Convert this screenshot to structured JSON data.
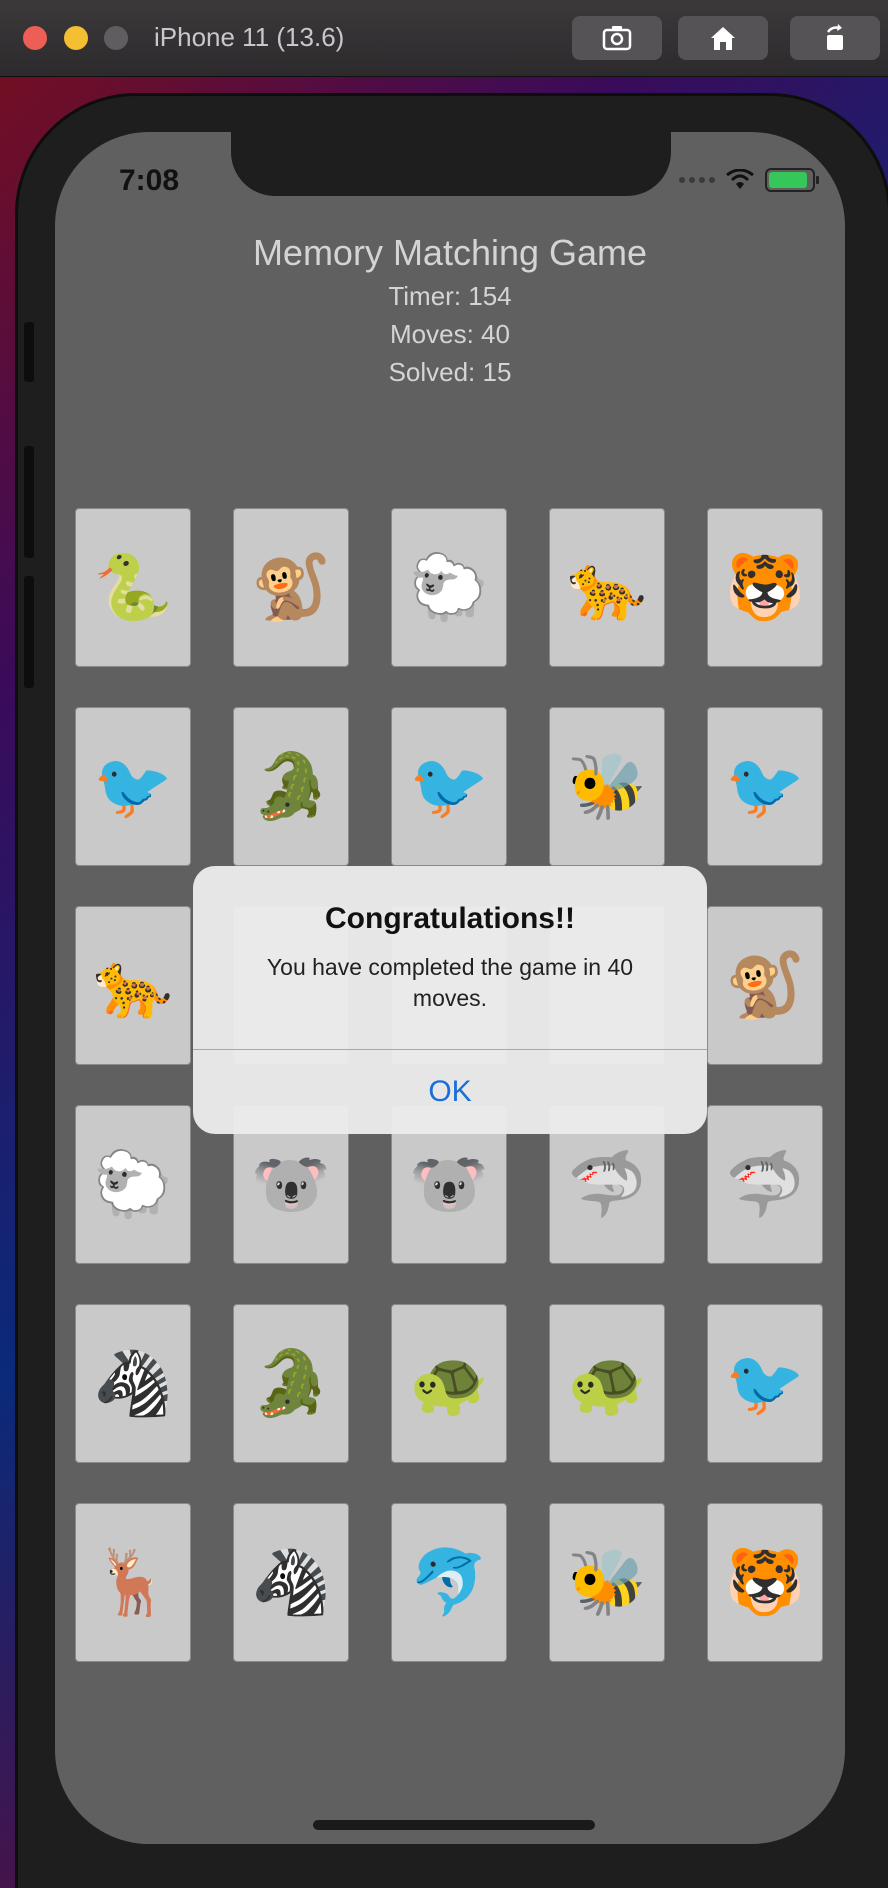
{
  "window": {
    "title": "iPhone 11 (13.6)"
  },
  "status_bar": {
    "time": "7:08"
  },
  "game": {
    "title": "Memory Matching Game",
    "timer": "Timer: 154",
    "moves": "Moves: 40",
    "solved": "Solved: 15"
  },
  "cards": [
    {
      "animal": "snake",
      "glyph": "🐍"
    },
    {
      "animal": "lemur",
      "glyph": "🐒"
    },
    {
      "animal": "sheep",
      "glyph": "🐑"
    },
    {
      "animal": "cheetah",
      "glyph": "🐆"
    },
    {
      "animal": "tiger",
      "glyph": "🐯"
    },
    {
      "animal": "toucan",
      "glyph": "🐦"
    },
    {
      "animal": "crocodile",
      "glyph": "🐊"
    },
    {
      "animal": "toucan",
      "glyph": "🐦"
    },
    {
      "animal": "bee",
      "glyph": "🐝"
    },
    {
      "animal": "ostrich",
      "glyph": "🐦"
    },
    {
      "animal": "cheetah",
      "glyph": "🐆"
    },
    {
      "animal": "hidden",
      "glyph": ""
    },
    {
      "animal": "hidden",
      "glyph": ""
    },
    {
      "animal": "hidden",
      "glyph": ""
    },
    {
      "animal": "lemur",
      "glyph": "🐒"
    },
    {
      "animal": "sheep",
      "glyph": "🐑"
    },
    {
      "animal": "koala",
      "glyph": "🐨"
    },
    {
      "animal": "koala",
      "glyph": "🐨"
    },
    {
      "animal": "shark",
      "glyph": "🦈"
    },
    {
      "animal": "shark",
      "glyph": "🦈"
    },
    {
      "animal": "zebra",
      "glyph": "🦓"
    },
    {
      "animal": "crocodile",
      "glyph": "🐊"
    },
    {
      "animal": "turtle",
      "glyph": "🐢"
    },
    {
      "animal": "turtle",
      "glyph": "🐢"
    },
    {
      "animal": "ostrich",
      "glyph": "🐦"
    },
    {
      "animal": "deer",
      "glyph": "🦌"
    },
    {
      "animal": "zebra",
      "glyph": "🦓"
    },
    {
      "animal": "dolphin",
      "glyph": "🐬"
    },
    {
      "animal": "bee",
      "glyph": "🐝"
    },
    {
      "animal": "tiger",
      "glyph": "🐯"
    }
  ],
  "alert": {
    "title": "Congratulations!!",
    "message": "You have completed the game in 40 moves.",
    "ok_label": "OK"
  }
}
